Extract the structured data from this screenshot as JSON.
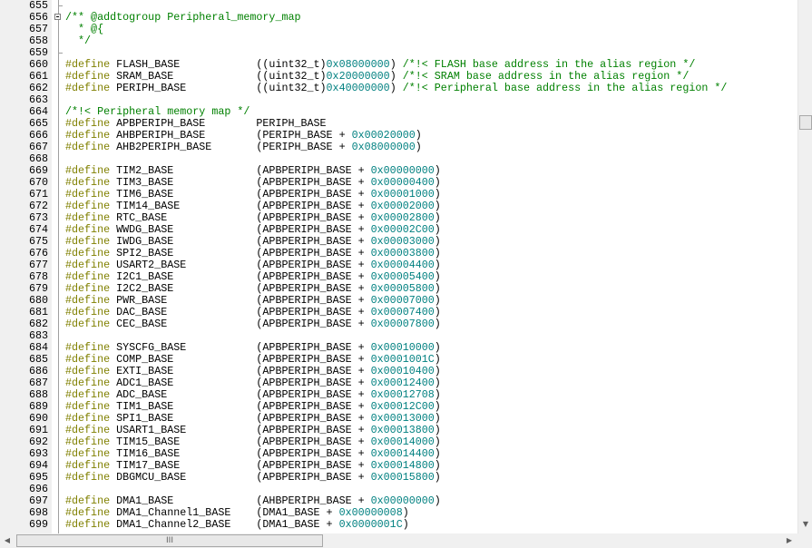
{
  "colors": {
    "keyword": "#808000",
    "number": "#008080",
    "comment": "#008000",
    "text": "#000000",
    "gutter": "#f0f0f0"
  },
  "icons": {
    "fold": "fold-minus-icon",
    "scroll_down": "arrow-down-icon",
    "scroll_left": "arrow-left-icon",
    "scroll_right": "arrow-right-icon",
    "grip": "grip-icon"
  },
  "scrollbar": {
    "grip": "III",
    "down": "▼",
    "left": "◀",
    "right": "▶"
  },
  "lines": [
    {
      "n": "655",
      "code": ""
    },
    {
      "n": "656",
      "code": "/** @addtogroup Peripheral_memory_map"
    },
    {
      "n": "657",
      "code": "  * @{"
    },
    {
      "n": "658",
      "code": "  */"
    },
    {
      "n": "659",
      "code": ""
    },
    {
      "n": "660",
      "code": "#define FLASH_BASE            ((uint32_t)0x08000000) /*!< FLASH base address in the alias region */"
    },
    {
      "n": "661",
      "code": "#define SRAM_BASE             ((uint32_t)0x20000000) /*!< SRAM base address in the alias region */"
    },
    {
      "n": "662",
      "code": "#define PERIPH_BASE           ((uint32_t)0x40000000) /*!< Peripheral base address in the alias region */"
    },
    {
      "n": "663",
      "code": ""
    },
    {
      "n": "664",
      "code": "/*!< Peripheral memory map */"
    },
    {
      "n": "665",
      "code": "#define APBPERIPH_BASE        PERIPH_BASE"
    },
    {
      "n": "666",
      "code": "#define AHBPERIPH_BASE        (PERIPH_BASE + 0x00020000)"
    },
    {
      "n": "667",
      "code": "#define AHB2PERIPH_BASE       (PERIPH_BASE + 0x08000000)"
    },
    {
      "n": "668",
      "code": ""
    },
    {
      "n": "669",
      "code": "#define TIM2_BASE             (APBPERIPH_BASE + 0x00000000)"
    },
    {
      "n": "670",
      "code": "#define TIM3_BASE             (APBPERIPH_BASE + 0x00000400)"
    },
    {
      "n": "671",
      "code": "#define TIM6_BASE             (APBPERIPH_BASE + 0x00001000)"
    },
    {
      "n": "672",
      "code": "#define TIM14_BASE            (APBPERIPH_BASE + 0x00002000)"
    },
    {
      "n": "673",
      "code": "#define RTC_BASE              (APBPERIPH_BASE + 0x00002800)"
    },
    {
      "n": "674",
      "code": "#define WWDG_BASE             (APBPERIPH_BASE + 0x00002C00)"
    },
    {
      "n": "675",
      "code": "#define IWDG_BASE             (APBPERIPH_BASE + 0x00003000)"
    },
    {
      "n": "676",
      "code": "#define SPI2_BASE             (APBPERIPH_BASE + 0x00003800)"
    },
    {
      "n": "677",
      "code": "#define USART2_BASE           (APBPERIPH_BASE + 0x00004400)"
    },
    {
      "n": "678",
      "code": "#define I2C1_BASE             (APBPERIPH_BASE + 0x00005400)"
    },
    {
      "n": "679",
      "code": "#define I2C2_BASE             (APBPERIPH_BASE + 0x00005800)"
    },
    {
      "n": "680",
      "code": "#define PWR_BASE              (APBPERIPH_BASE + 0x00007000)"
    },
    {
      "n": "681",
      "code": "#define DAC_BASE              (APBPERIPH_BASE + 0x00007400)"
    },
    {
      "n": "682",
      "code": "#define CEC_BASE              (APBPERIPH_BASE + 0x00007800)"
    },
    {
      "n": "683",
      "code": ""
    },
    {
      "n": "684",
      "code": "#define SYSCFG_BASE           (APBPERIPH_BASE + 0x00010000)"
    },
    {
      "n": "685",
      "code": "#define COMP_BASE             (APBPERIPH_BASE + 0x0001001C)"
    },
    {
      "n": "686",
      "code": "#define EXTI_BASE             (APBPERIPH_BASE + 0x00010400)"
    },
    {
      "n": "687",
      "code": "#define ADC1_BASE             (APBPERIPH_BASE + 0x00012400)"
    },
    {
      "n": "688",
      "code": "#define ADC_BASE              (APBPERIPH_BASE + 0x00012708)"
    },
    {
      "n": "689",
      "code": "#define TIM1_BASE             (APBPERIPH_BASE + 0x00012C00)"
    },
    {
      "n": "690",
      "code": "#define SPI1_BASE             (APBPERIPH_BASE + 0x00013000)"
    },
    {
      "n": "691",
      "code": "#define USART1_BASE           (APBPERIPH_BASE + 0x00013800)"
    },
    {
      "n": "692",
      "code": "#define TIM15_BASE            (APBPERIPH_BASE + 0x00014000)"
    },
    {
      "n": "693",
      "code": "#define TIM16_BASE            (APBPERIPH_BASE + 0x00014400)"
    },
    {
      "n": "694",
      "code": "#define TIM17_BASE            (APBPERIPH_BASE + 0x00014800)"
    },
    {
      "n": "695",
      "code": "#define DBGMCU_BASE           (APBPERIPH_BASE + 0x00015800)"
    },
    {
      "n": "696",
      "code": ""
    },
    {
      "n": "697",
      "code": "#define DMA1_BASE             (AHBPERIPH_BASE + 0x00000000)"
    },
    {
      "n": "698",
      "code": "#define DMA1_Channel1_BASE    (DMA1_BASE + 0x00000008)"
    },
    {
      "n": "699",
      "code": "#define DMA1_Channel2_BASE    (DMA1_BASE + 0x0000001C)"
    }
  ]
}
